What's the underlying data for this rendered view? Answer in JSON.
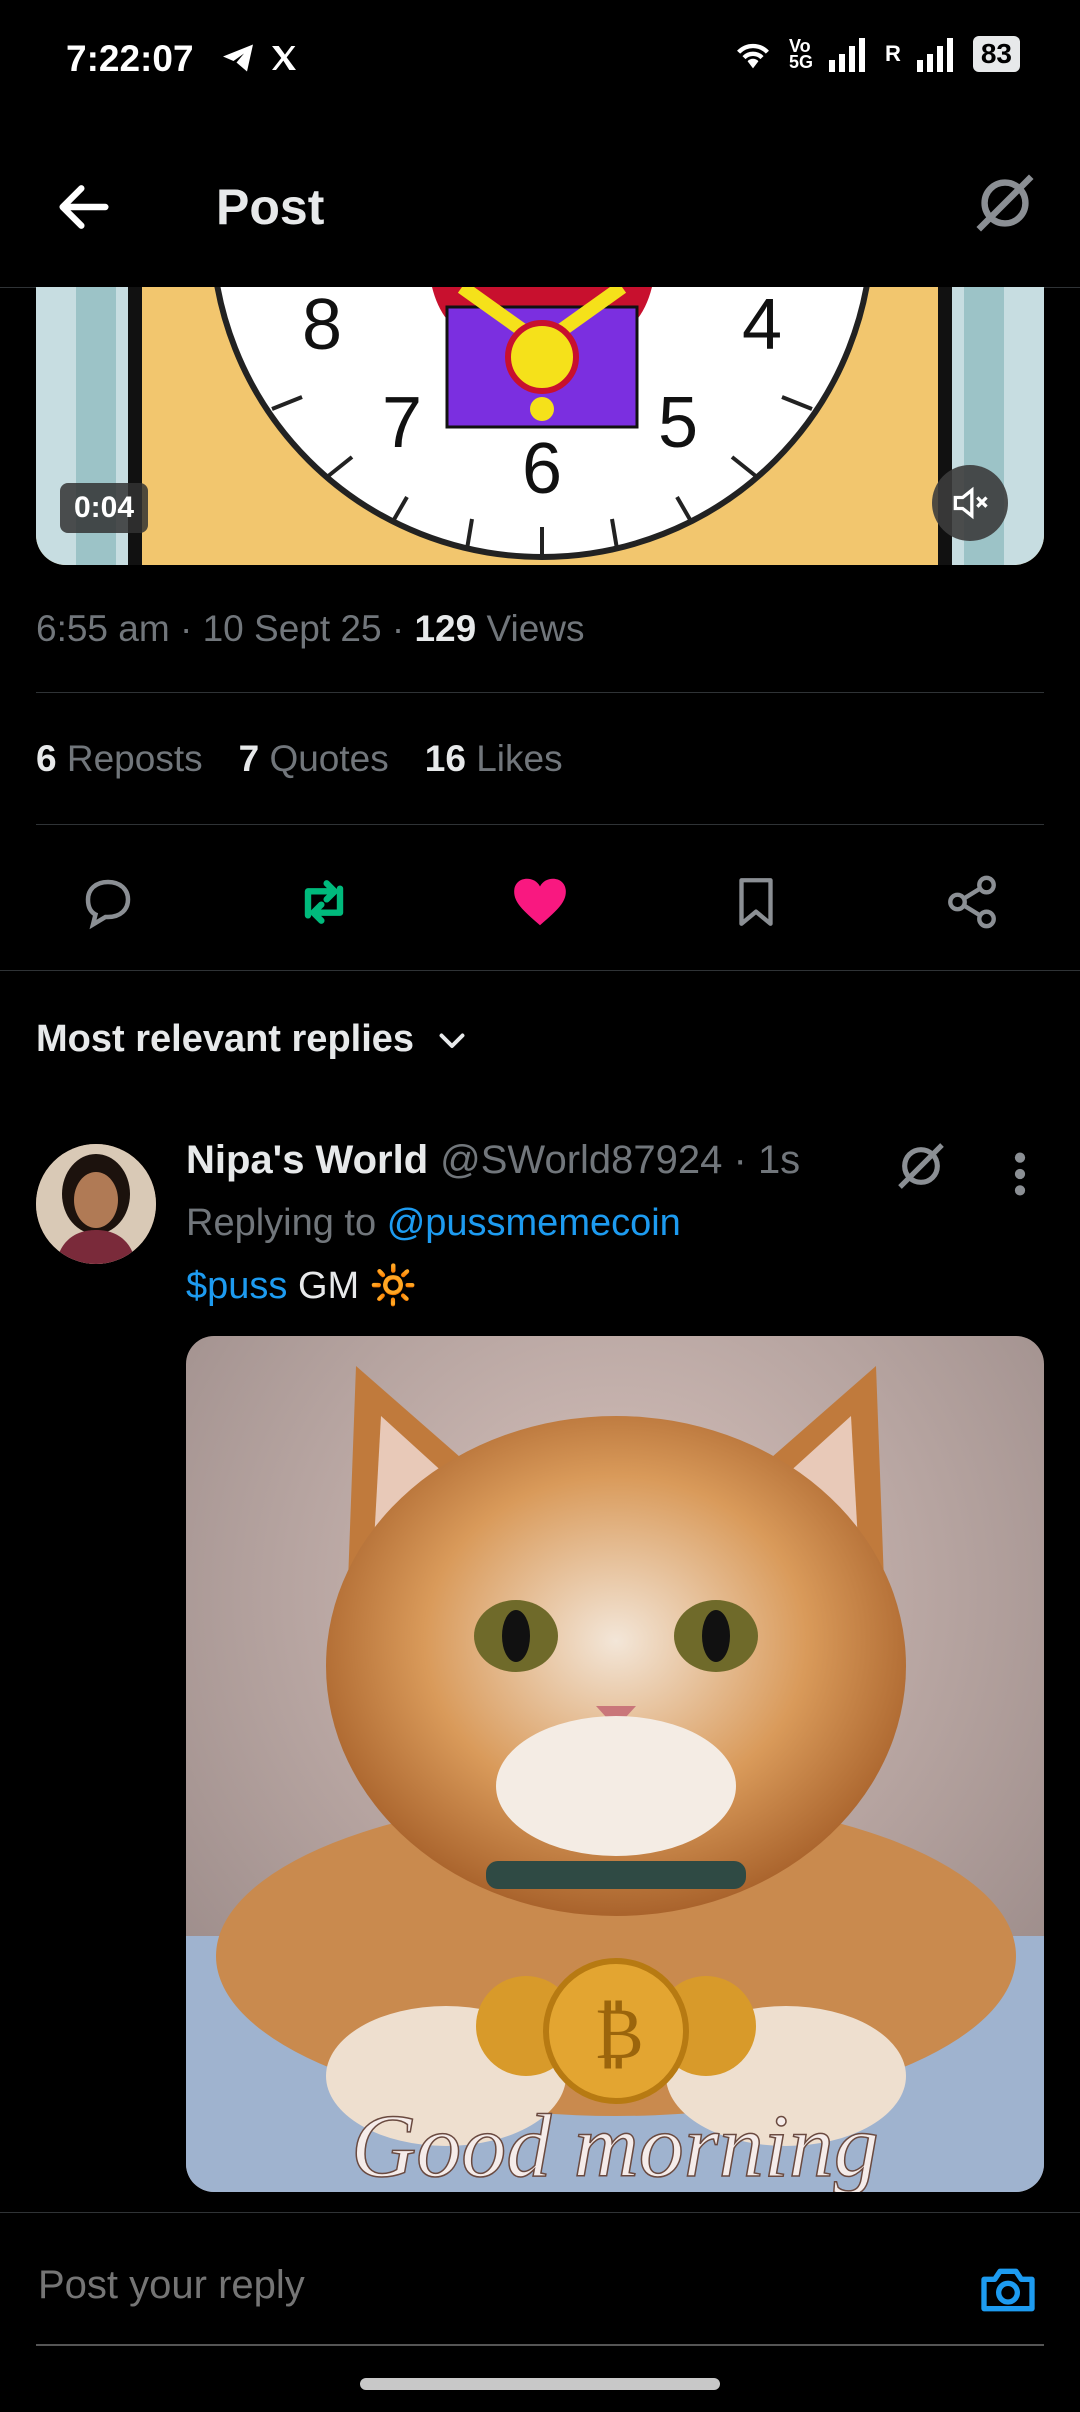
{
  "status": {
    "time": "7:22:07",
    "small_top": "Vo",
    "small_bottom": "5G",
    "roaming": "R",
    "battery": "83"
  },
  "header": {
    "title": "Post"
  },
  "video": {
    "elapsed": "0:04"
  },
  "post": {
    "time": "6:55 am",
    "date": "10 Sept 25",
    "views_count": "129",
    "views_label": "Views",
    "reposts_count": "6",
    "reposts_label": "Reposts",
    "quotes_count": "7",
    "quotes_label": "Quotes",
    "likes_count": "16",
    "likes_label": "Likes"
  },
  "replies": {
    "sort_label": "Most relevant replies"
  },
  "reply": {
    "name": "Nipa's World",
    "handle": "@SWorld87924",
    "age": "1s",
    "replying_prefix": "Replying to",
    "replying_handle": "@pussmemecoin",
    "cashtag": "$puss",
    "text": "GM 🔆",
    "image_caption": "Good morning"
  },
  "composer": {
    "placeholder": "Post your reply"
  },
  "colors": {
    "accent": "#1d9bf0",
    "like": "#f91880",
    "repost": "#00ba7c"
  }
}
